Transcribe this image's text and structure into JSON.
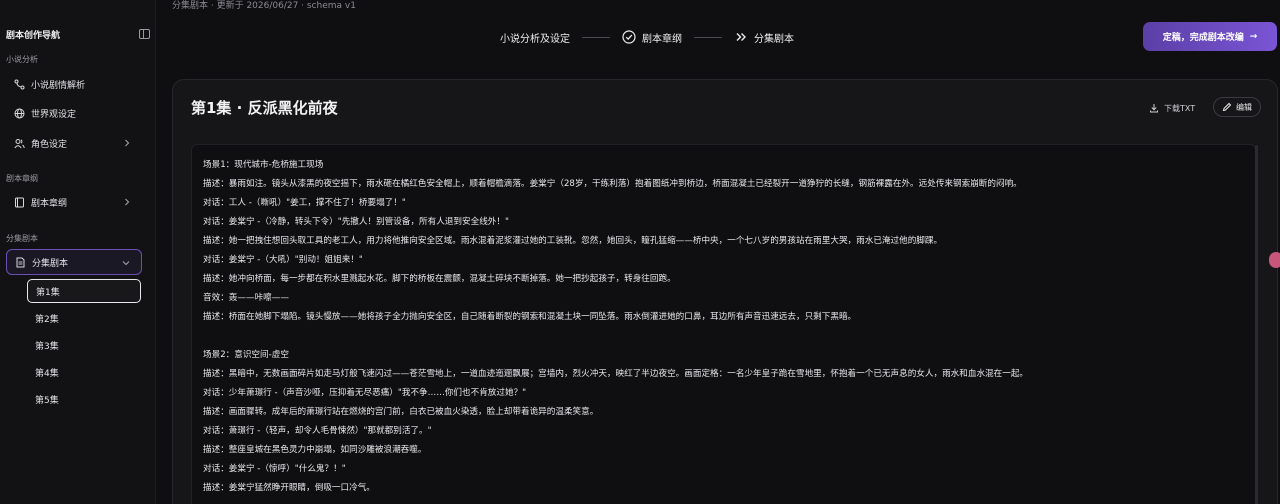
{
  "header": {
    "breadcrumb": "分集剧本 · 更新于 2026/06/27 · schema v1",
    "steps": [
      {
        "label": "小说分析及设定",
        "icon": "none"
      },
      {
        "label": "剧本章纲",
        "icon": "check-circle-icon"
      },
      {
        "label": "分集剧本",
        "icon": "double-chevron-right-icon"
      }
    ],
    "finish_label": "定稿，完成剧本改编",
    "finish_arrow": "→"
  },
  "sidebar": {
    "title": "剧本创作导航",
    "sections": {
      "novel": "小说分析",
      "outline": "剧本章纲",
      "episodes": "分集剧本"
    },
    "items": {
      "plot": "小说剧情解析",
      "world": "世界观设定",
      "character": "角色设定",
      "chapter": "剧本章纲",
      "episodes": "分集剧本"
    },
    "episode_list": [
      "第1集",
      "第2集",
      "第3集",
      "第4集",
      "第5集"
    ],
    "active_episode": "第1集"
  },
  "main": {
    "title": "第1集 · 反派黑化前夜",
    "download_label": "下载TXT",
    "edit_label": "编辑",
    "script_lines": [
      "场景1：现代城市-危桥施工现场",
      "描述：暴雨如注。镜头从漆黑的夜空摇下，雨水砸在橘红色安全帽上，顺着帽檐滴落。姜棠宁（28岁，干练利落）抱着图纸冲到桥边，桥面混凝土已经裂开一道狰狞的长缝，钢筋裸露在外。远处传来钢索崩断的闷响。",
      "对话：工人 -（嘶吼）\"姜工，撑不住了！桥要塌了！\"",
      "对话：姜棠宁 -（冷静，转头下令）\"先撤人！别管设备，所有人退到安全线外！\"",
      "描述：她一把拽住想回头取工具的老工人，用力将他推向安全区域。雨水混着泥浆灌过她的工装靴。忽然，她回头，瞳孔猛缩——桥中央，一个七八岁的男孩站在雨里大哭，雨水已淹过他的脚踝。",
      "对话：姜棠宁 -（大吼）\"别动！姐姐来！\"",
      "描述：她冲向桥面，每一步都在积水里溅起水花。脚下的桥板在震颤，混凝土碎块不断掉落。她一把抄起孩子，转身往回跑。",
      "音效：轰——咔嚓——",
      "描述：桥面在她脚下塌陷。镜头慢放——她将孩子全力抛向安全区，自己随着断裂的钢索和混凝土块一同坠落。雨水倒灌进她的口鼻，耳边所有声音迅速远去，只剩下黑暗。",
      "",
      "场景2：意识空间-虚空",
      "描述：黑暗中，无数画面碎片如走马灯般飞速闪过——苍茫雪地上，一道血迹迤逦飘展；宫墙内，烈火冲天，映红了半边夜空。画面定格：一名少年皇子跪在雪地里，怀抱着一个已无声息的女人，雨水和血水混在一起。",
      "对话：少年萧璟行 -（声音沙哑，压抑着无尽恶痛）\"我不争……你们也不肯放过她？\"",
      "描述：画面骤转。成年后的萧璟行站在燃烧的宫门前，白衣已被血火染透，脸上却带着诡异的温柔笑意。",
      "对话：萧璟行 -（轻声，却令人毛骨悚然）\"那就都别活了。\"",
      "描述：整座皇城在黑色灵力中崩塌，如同沙雕被浪潮吞噬。",
      "对话：姜棠宁 -（惊呼）\"什么鬼？！\"",
      "描述：姜棠宁猛然睁开眼睛，倒吸一口冷气。"
    ]
  }
}
